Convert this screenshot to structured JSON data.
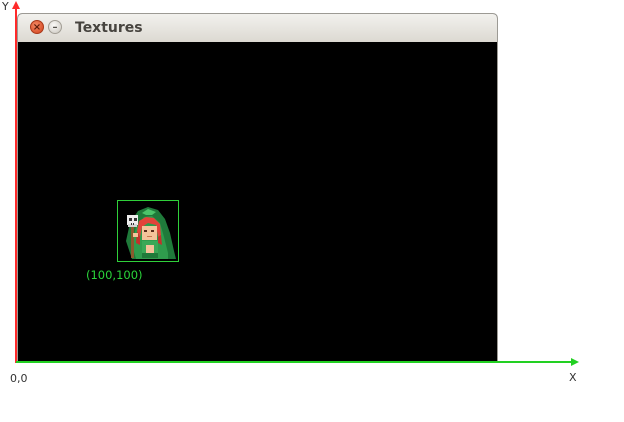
{
  "window": {
    "title": "Textures",
    "close_glyph": "×",
    "minimize_glyph": "–"
  },
  "sprite": {
    "icon": "hooded-wizard-with-skull-staff",
    "border_color": "#2fd03a"
  },
  "labels": {
    "sprite_position": "(100,100)",
    "origin": "0,0",
    "x_axis": "X",
    "y_axis": "Y"
  },
  "colors": {
    "x_axis": "#22d022",
    "y_axis": "#ff2a2a",
    "canvas_background": "#000000",
    "coord_text": "#2ad43a"
  }
}
